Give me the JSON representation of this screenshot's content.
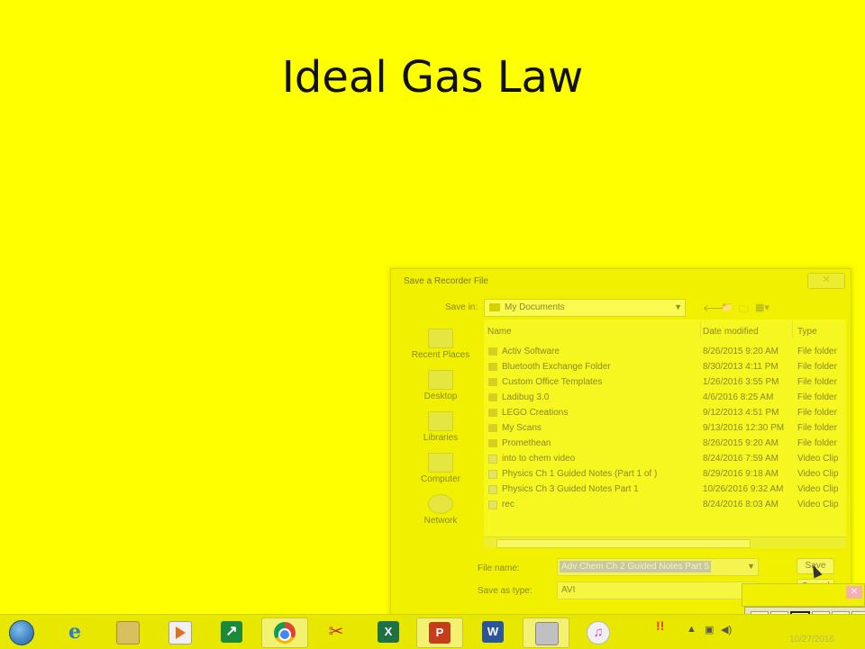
{
  "slide": {
    "title": "Ideal Gas Law"
  },
  "dialog": {
    "title": "Save a Recorder File",
    "close": "✕",
    "save_in_label": "Save in:",
    "save_in_value": "My Documents",
    "places": [
      "Recent Places",
      "Desktop",
      "Libraries",
      "Computer",
      "Network"
    ],
    "columns": {
      "name": "Name",
      "date": "Date modified",
      "type": "Type"
    },
    "files": [
      {
        "name": "Activ Software",
        "date": "8/26/2015 9:20 AM",
        "type": "File folder",
        "kind": "folder"
      },
      {
        "name": "Bluetooth Exchange Folder",
        "date": "8/30/2013 4:11 PM",
        "type": "File folder",
        "kind": "folder"
      },
      {
        "name": "Custom Office Templates",
        "date": "1/26/2016 3:55 PM",
        "type": "File folder",
        "kind": "folder"
      },
      {
        "name": "Ladibug 3.0",
        "date": "4/6/2016 8:25 AM",
        "type": "File folder",
        "kind": "folder"
      },
      {
        "name": "LEGO Creations",
        "date": "9/12/2013 4:51 PM",
        "type": "File folder",
        "kind": "folder"
      },
      {
        "name": "My Scans",
        "date": "9/13/2016 12:30 PM",
        "type": "File folder",
        "kind": "folder"
      },
      {
        "name": "Promethean",
        "date": "8/26/2015 9:20 AM",
        "type": "File folder",
        "kind": "folder"
      },
      {
        "name": "into to chem video",
        "date": "8/24/2016 7:59 AM",
        "type": "Video Clip",
        "kind": "video"
      },
      {
        "name": "Physics Ch 1 Guided Notes (Part 1 of )",
        "date": "8/29/2016 9:18 AM",
        "type": "Video Clip",
        "kind": "video"
      },
      {
        "name": "Physics Ch 3 Guided Notes Part 1",
        "date": "10/26/2016 9:32 AM",
        "type": "Video Clip",
        "kind": "video"
      },
      {
        "name": "rec",
        "date": "8/24/2016 8:03 AM",
        "type": "Video Clip",
        "kind": "video"
      }
    ],
    "file_name_label": "File name:",
    "file_name_value": "Adv Chem Ch 2 Guided Notes Part 5",
    "save_as_type_label": "Save as type:",
    "save_as_type_value": "AVI",
    "save_button": "Save",
    "cancel_button": "Cancel"
  },
  "recorder": {
    "m": "M",
    "x": "✕",
    "close": "✕"
  },
  "taskbar": {
    "excel": "X",
    "powerpoint": "P",
    "word": "W",
    "clock_date": "10/27/2016"
  },
  "colors": {
    "background": "#ffff00",
    "taskbar": "#e7e700"
  }
}
